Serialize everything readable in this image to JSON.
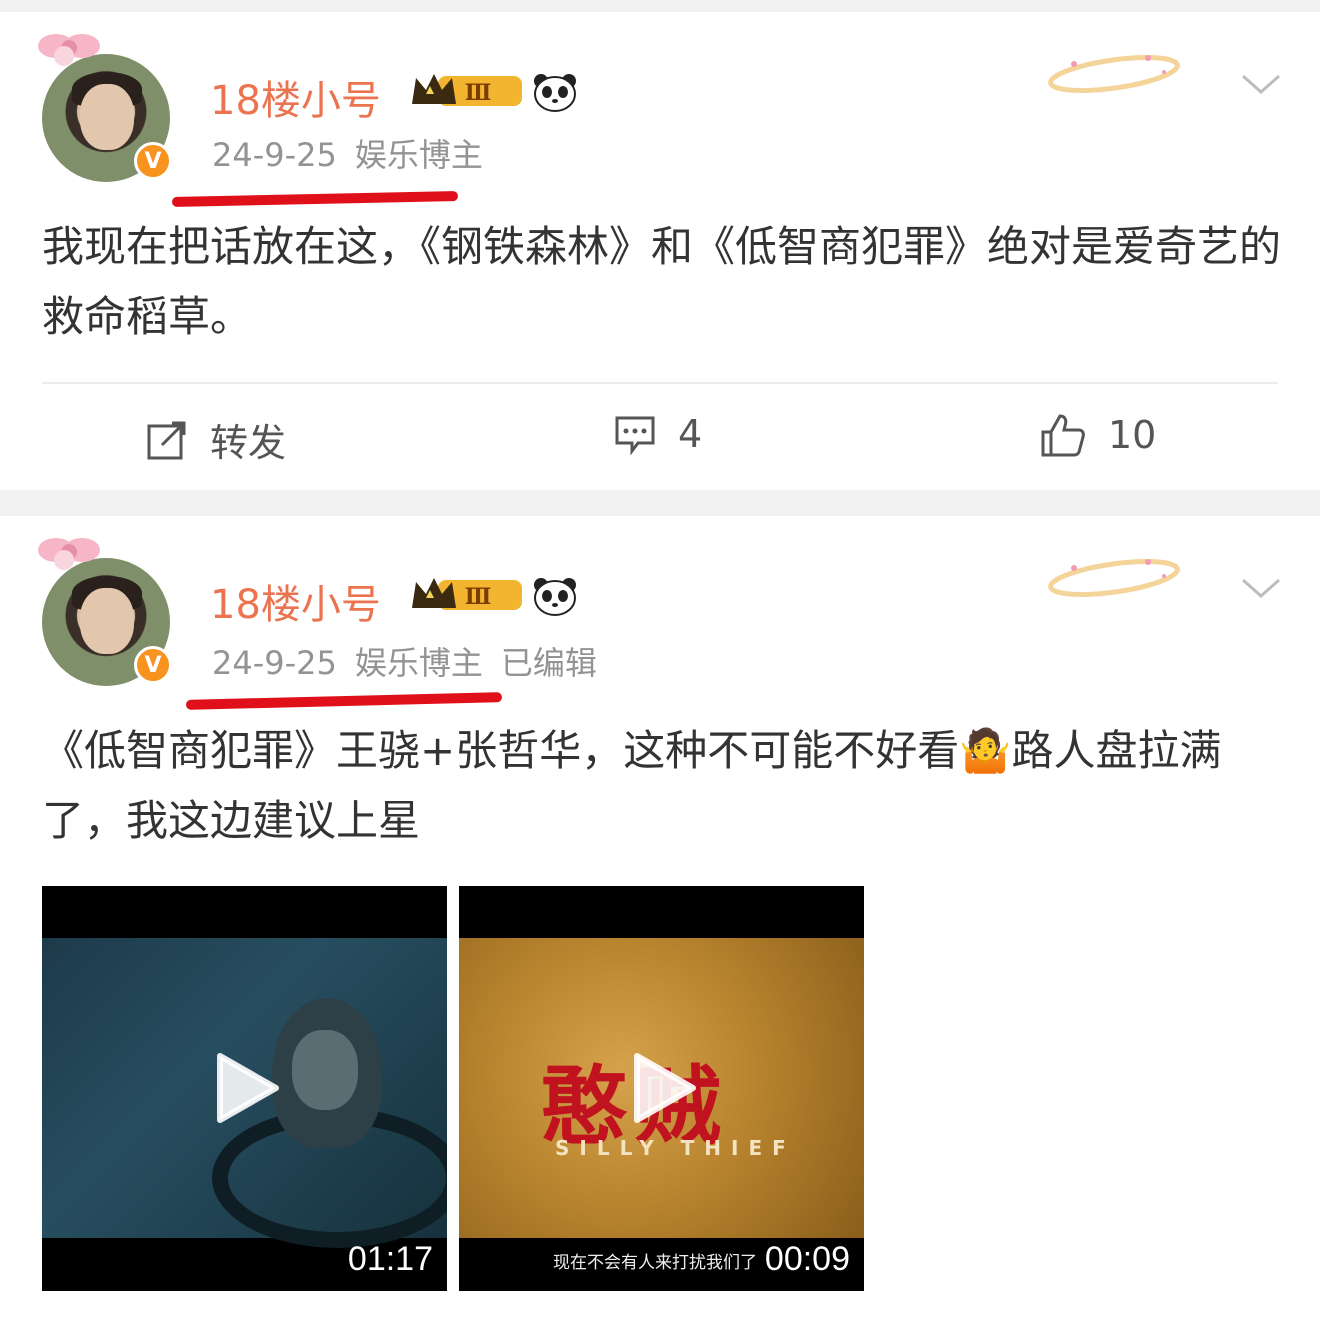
{
  "posts": [
    {
      "username": "18楼小号",
      "date": "24-9-25",
      "category": "娱乐博主",
      "edited": "",
      "text": "我现在把话放在这，《钢铁森林》和《低智商犯罪》绝对是爱奇艺的救命稻草。",
      "actions": {
        "repost": "转发",
        "comments": "4",
        "likes": "10"
      }
    },
    {
      "username": "18楼小号",
      "date": "24-9-25",
      "category": "娱乐博主",
      "edited": "已编辑",
      "text": "《低智商犯罪》王骁+张哲华，这种不可能不好看🤷路人盘拉满了，我这边建议上星",
      "videos": [
        {
          "duration": "01:17",
          "subtitle": ""
        },
        {
          "duration": "00:09",
          "subtitle": "现在不会有人来打扰我们了",
          "title_cn": "憨贼",
          "title_en": "SILLY THIEF"
        }
      ]
    }
  ],
  "badges": {
    "verified_letter": "V",
    "level_numeral": "Ⅲ"
  },
  "icons": [
    "edit-share-icon",
    "comment-icon",
    "thumbs-up-icon",
    "chevron-down-icon",
    "play-icon",
    "crown-badge-icon",
    "panda-icon",
    "halo-icon",
    "bow-icon"
  ],
  "colors": {
    "username": "#eb7350",
    "meta": "#939393",
    "annotation_line": "#e0101a",
    "verified": "#f7931e"
  }
}
